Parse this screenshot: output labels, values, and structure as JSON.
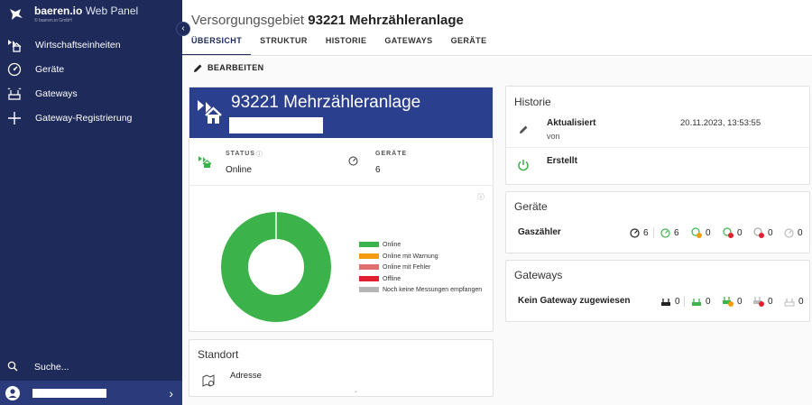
{
  "brand": {
    "name_bold": "baeren.io",
    "name_light": " Web Panel",
    "copyright": "© baeren.io GmbH"
  },
  "sidebar": {
    "items": [
      {
        "label": "Wirtschaftseinheiten",
        "icon": "building-icon"
      },
      {
        "label": "Geräte",
        "icon": "gauge-icon"
      },
      {
        "label": "Gateways",
        "icon": "router-icon"
      },
      {
        "label": "Gateway-Registrierung",
        "icon": "plus-icon"
      }
    ],
    "search_label": "Suche...",
    "collapse_icon": "chevron-left-icon",
    "user_chevron": "›"
  },
  "header": {
    "title_prefix": "Versorgungsgebiet ",
    "title_main": "93221 Mehrzähleranlage",
    "tabs": [
      {
        "label": "ÜBERSICHT",
        "active": true
      },
      {
        "label": "STRUKTUR",
        "active": false
      },
      {
        "label": "HISTORIE",
        "active": false
      },
      {
        "label": "GATEWAYS",
        "active": false
      },
      {
        "label": "GERÄTE",
        "active": false
      }
    ],
    "edit_label": "BEARBEITEN"
  },
  "overview": {
    "title": "93221 Mehrzähleranlage",
    "status_label": "STATUS",
    "status_value": "Online",
    "devices_label": "GERÄTE",
    "devices_value": "6"
  },
  "chart_data": {
    "type": "pie",
    "donut": true,
    "categories": [
      "Online",
      "Online mit Warnung",
      "Online mit Fehler",
      "Offline",
      "Noch keine Messungen empfangen"
    ],
    "values": [
      6,
      0,
      0,
      0,
      0
    ],
    "colors": [
      "#3cb34a",
      "#f39c12",
      "#e07070",
      "#e02030",
      "#b5b5b5"
    ],
    "legend_position": "right"
  },
  "standort": {
    "title": "Standort",
    "address_label": "Adresse"
  },
  "historie": {
    "title": "Historie",
    "rows": [
      {
        "label": "Aktualisiert",
        "sub": "von",
        "date": "20.11.2023, 13:53:55",
        "icon": "pencil-icon"
      },
      {
        "label": "Erstellt",
        "icon": "power-icon"
      }
    ]
  },
  "geraete": {
    "title": "Geräte",
    "row_label": "Gaszähler",
    "counts": [
      {
        "icon": "meter-total-icon",
        "value": "6"
      },
      {
        "icon": "meter-online-icon",
        "value": "6"
      },
      {
        "icon": "meter-warning-icon",
        "value": "0"
      },
      {
        "icon": "meter-error-icon",
        "value": "0"
      },
      {
        "icon": "meter-offline-icon",
        "value": "0"
      },
      {
        "icon": "meter-nodata-icon",
        "value": "0"
      }
    ]
  },
  "gateways": {
    "title": "Gateways",
    "row_label": "Kein Gateway zugewiesen",
    "counts": [
      {
        "icon": "gateway-total-icon",
        "value": "0"
      },
      {
        "icon": "gateway-online-icon",
        "value": "0"
      },
      {
        "icon": "gateway-warning-icon",
        "value": "0"
      },
      {
        "icon": "gateway-offline-icon",
        "value": "0"
      },
      {
        "icon": "gateway-nodata-icon",
        "value": "0"
      }
    ]
  }
}
